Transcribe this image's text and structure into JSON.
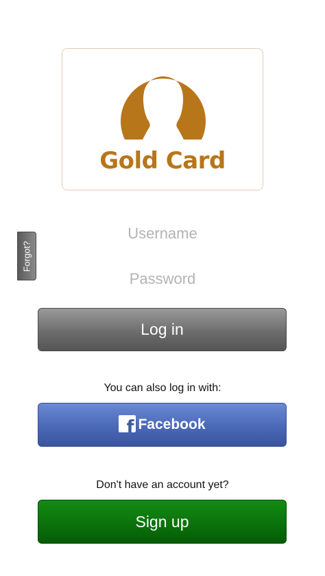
{
  "brand": {
    "name": "Gold Card",
    "color": "#b8761a"
  },
  "login_form": {
    "forgot_label": "Forgot?",
    "username_placeholder": "Username",
    "password_placeholder": "Password",
    "login_label": "Log in"
  },
  "social": {
    "hint": "You can also log in with:",
    "facebook_label": "Facebook",
    "facebook_color": "#4a68b6",
    "icon": "facebook-icon"
  },
  "signup": {
    "hint": "Don't have an account yet?",
    "label": "Sign up",
    "color": "#0b720b"
  }
}
